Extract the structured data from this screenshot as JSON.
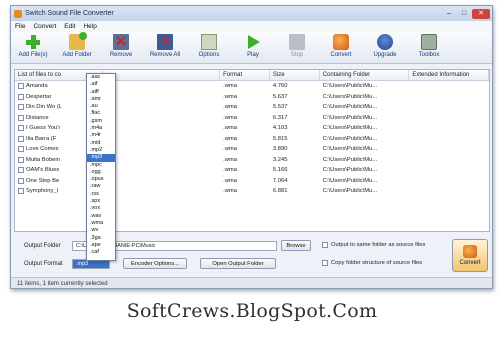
{
  "window": {
    "title": "Switch Sound File Converter"
  },
  "menu": [
    "File",
    "Convert",
    "Edit",
    "Help"
  ],
  "toolbar": [
    {
      "label": "Add File(s)",
      "icon": "add-icon"
    },
    {
      "label": "Add Folder",
      "icon": "folder-icon"
    },
    {
      "label": "Remove",
      "icon": "remove-icon"
    },
    {
      "label": "Remove All",
      "icon": "remove-all-icon"
    },
    {
      "label": "Options",
      "icon": "options-icon"
    },
    {
      "label": "Play",
      "icon": "play-icon"
    },
    {
      "label": "Stop",
      "icon": "stop-icon"
    },
    {
      "label": "Convert",
      "icon": "convert-icon"
    },
    {
      "label": "Upgrade",
      "icon": "upgrade-icon"
    },
    {
      "label": "Toolbox",
      "icon": "toolbox-icon"
    }
  ],
  "columns": [
    "List of files to co",
    "Format",
    "Size",
    "Containing Folder",
    "Extended Information"
  ],
  "rows": [
    {
      "name": "Amanda",
      "format": ".wma",
      "size": "4.760",
      "folder": "C:\\Users\\Public\\Mu..."
    },
    {
      "name": "Despertar",
      "format": ".wma",
      "size": "5.637",
      "folder": "C:\\Users\\Public\\Mu..."
    },
    {
      "name": "Din Din Wo (L",
      "format": ".wma",
      "size": "5.537",
      "folder": "C:\\Users\\Public\\Mu..."
    },
    {
      "name": "Distance",
      "format": ".wma",
      "size": "6.317",
      "folder": "C:\\Users\\Public\\Mu..."
    },
    {
      "name": "I Guess You'r",
      "format": ".wma",
      "size": "4.103",
      "folder": "C:\\Users\\Public\\Mu..."
    },
    {
      "name": "Ilia Barra (F",
      "format": ".wma",
      "size": "5.815",
      "folder": "C:\\Users\\Public\\Mu..."
    },
    {
      "name": "Love Comes",
      "format": ".wma",
      "size": "3.890",
      "folder": "C:\\Users\\Public\\Mu..."
    },
    {
      "name": "Muita Bobein",
      "format": ".wma",
      "size": "3.245",
      "folder": "C:\\Users\\Public\\Mu..."
    },
    {
      "name": "OAM's Blues",
      "format": ".wma",
      "size": "5.166",
      "folder": "C:\\Users\\Public\\Mu..."
    },
    {
      "name": "One Step Be",
      "format": ".wma",
      "size": "7.064",
      "folder": "C:\\Users\\Public\\Mu..."
    },
    {
      "name": "Symphony_I",
      "format": ".wma",
      "size": "6.881",
      "folder": "C:\\Users\\Public\\Mu..."
    }
  ],
  "format_options": [
    ".aac",
    ".aif",
    ".aiff",
    ".amr",
    ".au",
    ".flac",
    ".gsm",
    ".m4a",
    ".m4r",
    ".mid",
    ".mp2",
    ".mp3",
    ".mpc",
    ".ogg",
    ".opus",
    ".raw",
    ".rss",
    ".spx",
    ".vox",
    ".wav",
    ".wma",
    ".wv",
    ".3ga",
    ".ape",
    ".caf"
  ],
  "format_selected_index": 11,
  "bottom": {
    "output_folder_label": "Output Folder",
    "output_folder_value": "C:\\Users\\STEPHANIE-PC\\Music",
    "browse_label": "Browse",
    "output_format_label": "Output Format",
    "output_format_value": ".mp3",
    "encoder_options_label": "Encoder Options...",
    "open_output_folder_label": "Open Output Folder",
    "same_folder_label": "Output to same folder as source files",
    "copy_structure_label": "Copy folder structure of source files",
    "convert_label": "Convert"
  },
  "status": "11 items, 1 item currently selected",
  "watermark": "SoftCrews.BlogSpot.Com"
}
